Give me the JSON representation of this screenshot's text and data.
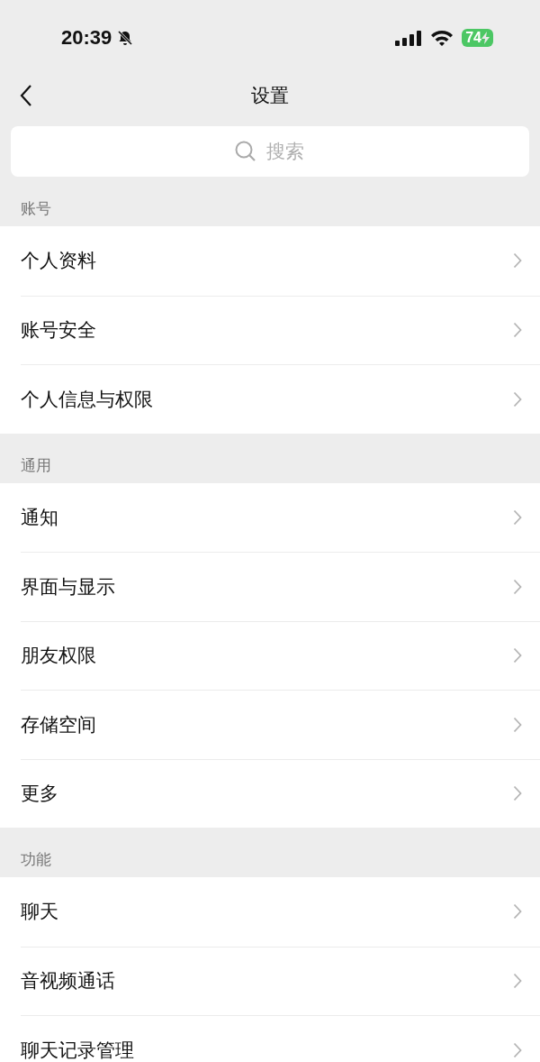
{
  "status_bar": {
    "time": "20:39",
    "battery": "74"
  },
  "nav": {
    "title": "设置"
  },
  "search": {
    "placeholder": "搜索"
  },
  "sections": [
    {
      "title": "账号",
      "items": [
        {
          "label": "个人资料"
        },
        {
          "label": "账号安全"
        },
        {
          "label": "个人信息与权限"
        }
      ]
    },
    {
      "title": "通用",
      "items": [
        {
          "label": "通知"
        },
        {
          "label": "界面与显示"
        },
        {
          "label": "朋友权限"
        },
        {
          "label": "存储空间"
        },
        {
          "label": "更多"
        }
      ]
    },
    {
      "title": "功能",
      "items": [
        {
          "label": "聊天"
        },
        {
          "label": "音视频通话"
        },
        {
          "label": "聊天记录管理"
        }
      ]
    }
  ]
}
